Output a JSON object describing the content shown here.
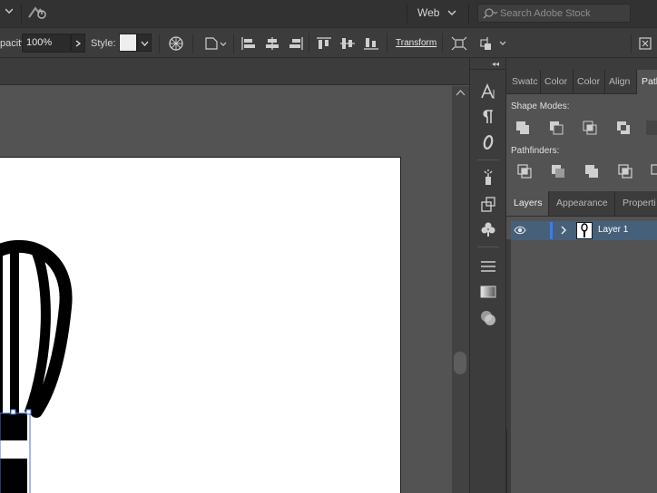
{
  "appbar": {
    "workspace": "Web",
    "stock_search": {
      "placeholder": "Search Adobe Stock"
    }
  },
  "controlbar": {
    "opacity_label": "pacity:",
    "opacity_value": "100%",
    "style_label": "Style:",
    "transform_label": "Transform"
  },
  "panels": {
    "top_tabs": [
      "Swatc",
      "Color",
      "Color",
      "Align",
      "Path"
    ],
    "pathfinder": {
      "shape_modes_label": "Shape Modes:",
      "pathfinders_label": "Pathfinders:"
    },
    "bottom_tabs": [
      "Layers",
      "Appearance",
      "Properti"
    ],
    "layers": [
      {
        "name": "Layer 1",
        "visible": true,
        "color": "#3b7af2"
      }
    ]
  },
  "colors": {
    "app_bar": "#323232",
    "control_bar": "#3c3c3c",
    "canvas_bg": "#535353",
    "artboard": "#ffffff",
    "selection_highlight": "#46607a",
    "layer_color": "#3b7af2"
  },
  "icons": {
    "appbar": [
      "chevron-down-icon",
      "gpu-performance-icon",
      "search-icon"
    ],
    "controlbar": [
      "recolor-artwork-icon",
      "transform-shape-icon",
      "align-left-icon",
      "align-horizontal-center-icon",
      "align-right-icon",
      "align-top-icon",
      "align-vertical-center-icon",
      "align-bottom-icon",
      "isolate-icon",
      "puppet-warp-icon"
    ],
    "tools": [
      "character-icon",
      "paragraph-icon",
      "opentype-icon",
      "symbols-sprayer-icon",
      "transform-icon",
      "club-symbol-icon",
      "stroke-lines-icon",
      "gradient-icon",
      "transparency-icon"
    ]
  }
}
